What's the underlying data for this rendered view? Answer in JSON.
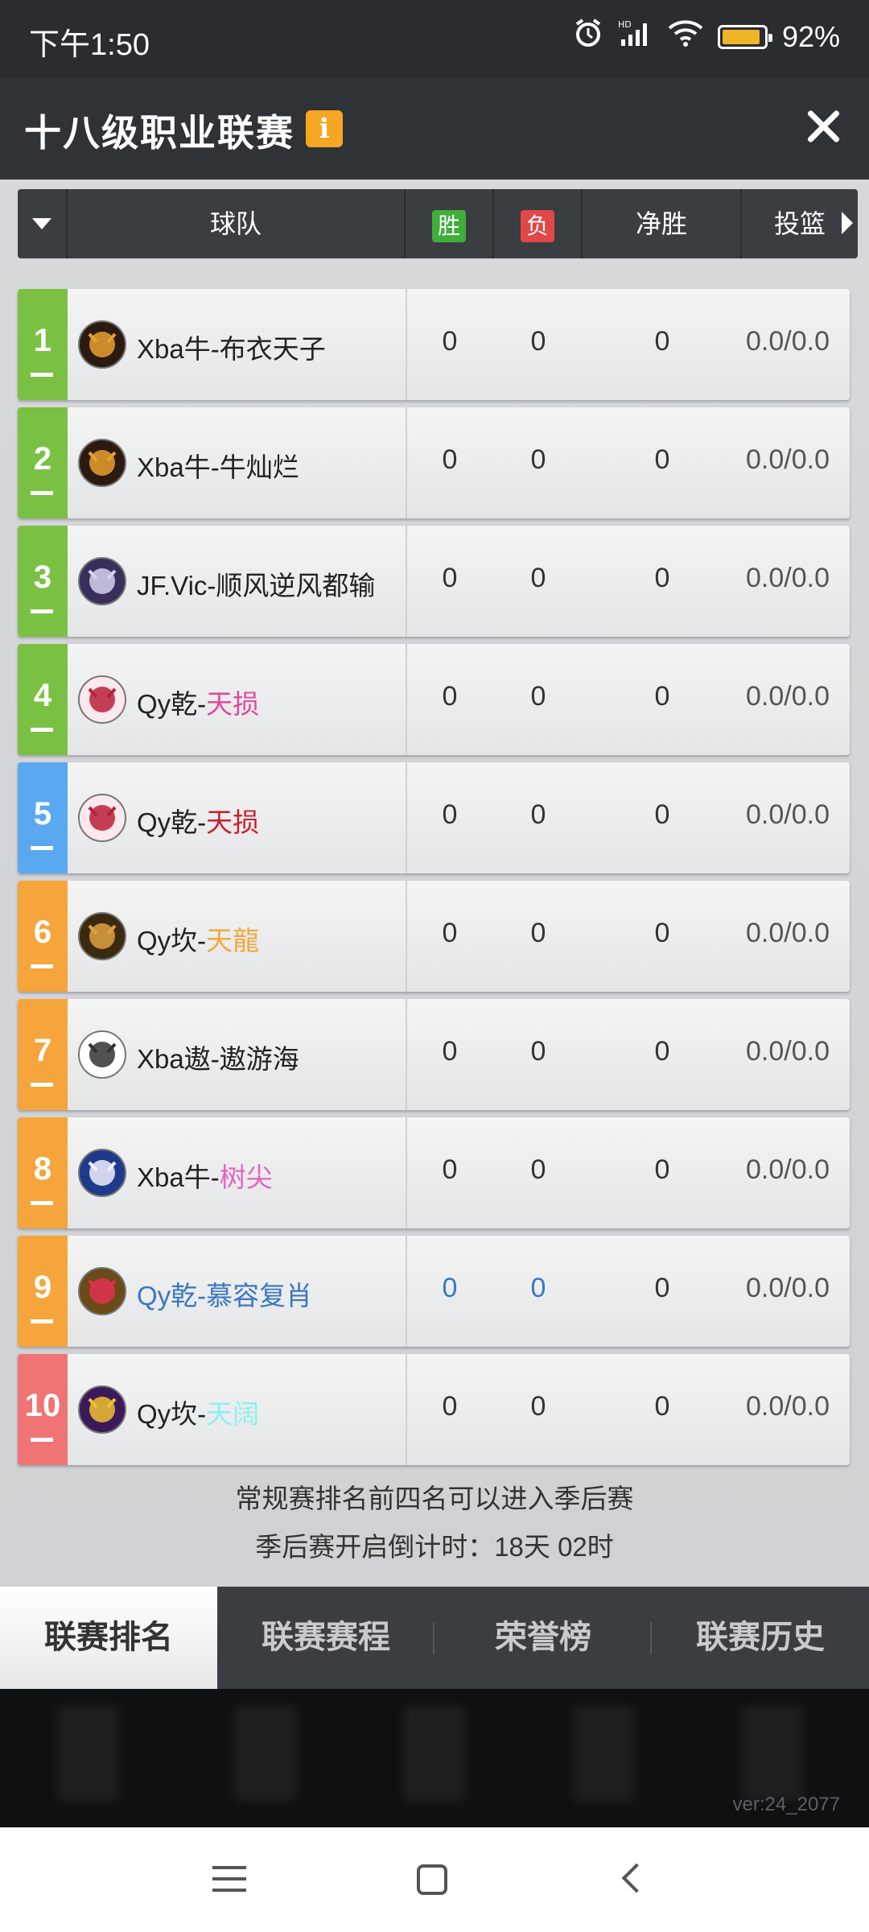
{
  "status_bar": {
    "time": "下午1:50",
    "battery": "92%",
    "battery_level": 0.92
  },
  "header": {
    "title": "十八级职业联赛",
    "info_icon": "i"
  },
  "table": {
    "columns": {
      "team": "球队",
      "win": "胜",
      "loss": "负",
      "net": "净胜",
      "shot": "投篮"
    },
    "rows": [
      {
        "rank": "1",
        "team": "Xba牛-布衣天子",
        "team_prefix": "Xba牛-布衣天子",
        "team_suffix": "",
        "win": "0",
        "loss": "0",
        "net": "0",
        "shot": "0.0/0.0",
        "rank_color": "#7ac143",
        "suffix_color": "#222222",
        "logo": "bull-logo"
      },
      {
        "rank": "2",
        "team": "Xba牛-牛灿烂",
        "team_prefix": "Xba牛-牛灿烂",
        "team_suffix": "",
        "win": "0",
        "loss": "0",
        "net": "0",
        "shot": "0.0/0.0",
        "rank_color": "#7ac143",
        "suffix_color": "#222222",
        "logo": "bull-logo"
      },
      {
        "rank": "3",
        "team": "JF.Vic-顺风逆风都输",
        "team_prefix": "JF.Vic-顺风逆风都输",
        "team_suffix": "",
        "win": "0",
        "loss": "0",
        "net": "0",
        "shot": "0.0/0.0",
        "rank_color": "#7ac143",
        "suffix_color": "#222222",
        "logo": "knight-logo"
      },
      {
        "rank": "4",
        "team": "Qy乾-天损",
        "team_prefix": "Qy乾-",
        "team_suffix": "天损",
        "win": "0",
        "loss": "0",
        "net": "0",
        "shot": "0.0/0.0",
        "rank_color": "#7ac143",
        "suffix_color": "#e0489c",
        "logo": "dragon-logo"
      },
      {
        "rank": "5",
        "team": "Qy乾-天损",
        "team_prefix": "Qy乾-",
        "team_suffix": "天损",
        "win": "0",
        "loss": "0",
        "net": "0",
        "shot": "0.0/0.0",
        "rank_color": "#5aa9f0",
        "suffix_color": "#c8202c",
        "logo": "dragon-logo"
      },
      {
        "rank": "6",
        "team": "Qy坎-天龍",
        "team_prefix": "Qy坎-",
        "team_suffix": "天龍",
        "win": "0",
        "loss": "0",
        "net": "0",
        "shot": "0.0/0.0",
        "rank_color": "#f5a53b",
        "suffix_color": "#f0a83a",
        "logo": "dog-logo"
      },
      {
        "rank": "7",
        "team": "Xba遨-遨游海",
        "team_prefix": "Xba遨-遨游海",
        "team_suffix": "",
        "win": "0",
        "loss": "0",
        "net": "0",
        "shot": "0.0/0.0",
        "rank_color": "#f5a53b",
        "suffix_color": "#222222",
        "logo": "spartan-logo"
      },
      {
        "rank": "8",
        "team": "Xba牛-树尖",
        "team_prefix": "Xba牛-",
        "team_suffix": "树尖",
        "win": "0",
        "loss": "0",
        "net": "0",
        "shot": "0.0/0.0",
        "rank_color": "#f5a53b",
        "suffix_color": "#e064c0",
        "logo": "eagle-logo"
      },
      {
        "rank": "9",
        "team": "Qy乾-慕容复肖",
        "team_prefix": "Qy乾-慕容复肖",
        "team_suffix": "",
        "win": "0",
        "loss": "0",
        "net": "0",
        "shot": "0.0/0.0",
        "rank_color": "#f5a53b",
        "suffix_color": "#3a78c0",
        "logo": "ball-logo",
        "highlight": true
      },
      {
        "rank": "10",
        "team": "Qy坎-天阔",
        "team_prefix": "Qy坎-",
        "team_suffix": "天阔",
        "win": "0",
        "loss": "0",
        "net": "0",
        "shot": "0.0/0.0",
        "rank_color": "#f07474",
        "suffix_color": "#8ef0f0",
        "logo": "wolf-logo"
      }
    ]
  },
  "notes": {
    "line1": "常规赛排名前四名可以进入季后赛",
    "line2": "季后赛开启倒计时：18天 02时"
  },
  "tabs": [
    {
      "label": "联赛排名",
      "active": true
    },
    {
      "label": "联赛赛程",
      "active": false
    },
    {
      "label": "荣誉榜",
      "active": false
    },
    {
      "label": "联赛历史",
      "active": false
    }
  ],
  "version": "ver:24_2077"
}
